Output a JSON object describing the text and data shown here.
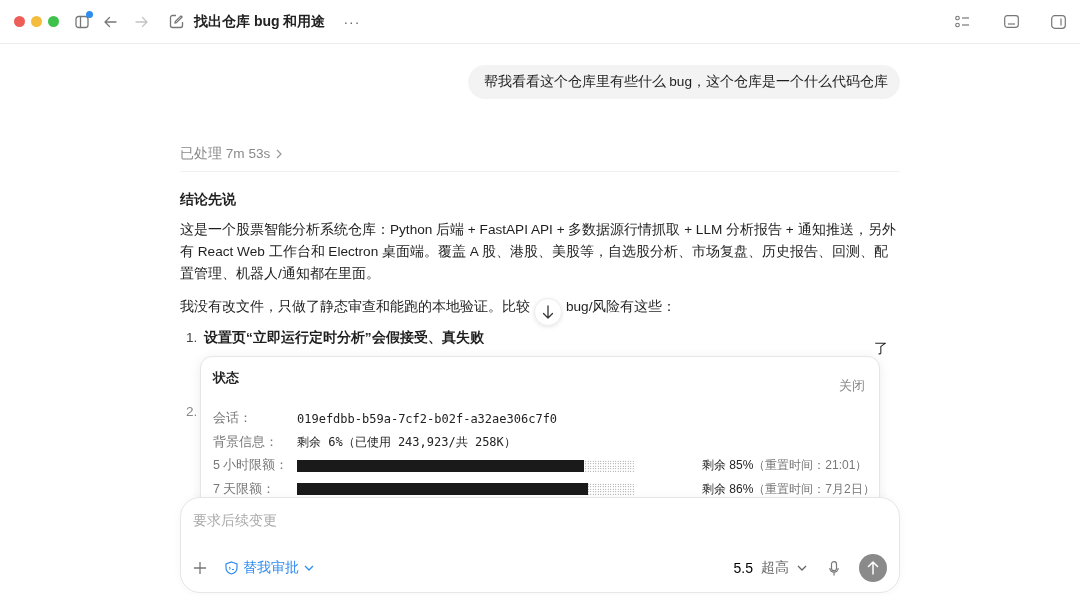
{
  "window": {
    "title": "找出仓库 bug 和用途",
    "sidebar_badge": true,
    "more": "···"
  },
  "user_message": "帮我看看这个仓库里有些什么 bug，这个仓库是一个什么代码仓库",
  "processed": "已处理 7m 53s",
  "reply": {
    "heading": "结论先说",
    "paragraphs": [
      "这是一个股票智能分析系统仓库：Python 后端 + FastAPI API + 多数据源行情抓取 + LLM 分析报告 + 通知推送，另外有 React Web 工作台和 Electron 桌面端。覆盖 A 股、港股、美股等，自选股分析、市场复盘、历史报告、回测、配置管理、机器人/通知都在里面。"
    ],
    "intro_before": "我没有改文件，只做了静态审查和能跑的本地验证。比较",
    "intro_after": "bug/风险有这些：",
    "list": [
      {
        "number": "1.",
        "text": "设置页“立即运行定时分析”会假接受、真失败",
        "overflow": "了"
      },
      {
        "number": "2."
      }
    ]
  },
  "status": {
    "title": "状态",
    "close": "关闭",
    "rows": [
      {
        "kind": "text",
        "label": "会话：",
        "value": "019efdbb-b59a-7cf2-b02f-a32ae306c7f0"
      },
      {
        "kind": "text",
        "label": "背景信息：",
        "value": "剩余 6%（已使用 243,923/共 258K）"
      },
      {
        "kind": "meter",
        "label": "5 小时限额：",
        "level": 0.85,
        "value": "剩余 85%",
        "note": "（重置时间：21:01）"
      },
      {
        "kind": "meter",
        "label": "7 天限额：",
        "level": 0.86,
        "value": "剩余 86%",
        "note": "（重置时间：7月2日）"
      }
    ]
  },
  "composer": {
    "placeholder": "要求后续变更",
    "approval": "替我审批",
    "model": "5.5",
    "effort": "超高"
  }
}
